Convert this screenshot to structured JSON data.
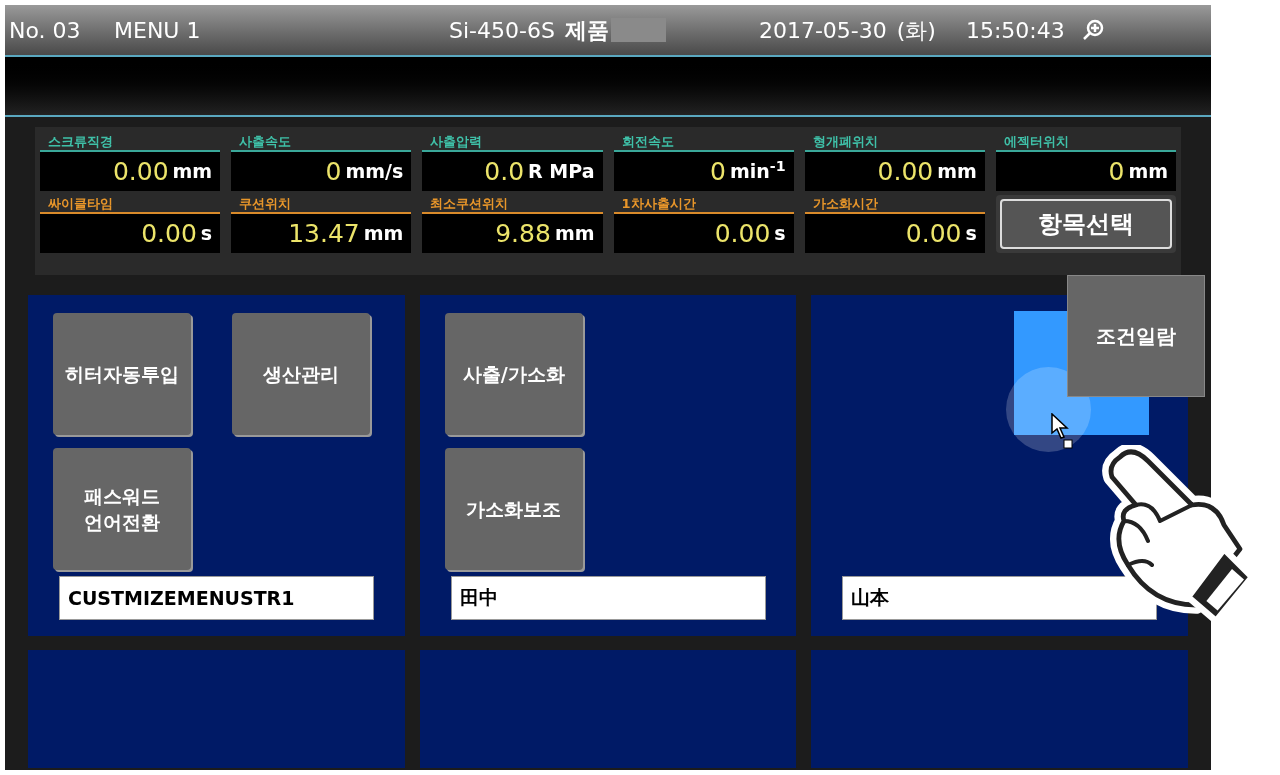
{
  "header": {
    "number": "No. 03",
    "menu": "MENU 1",
    "machine": "Si-450-6S",
    "product": "제품",
    "date": "2017-05-30",
    "weekday": "(화)",
    "time": "15:50:43"
  },
  "metrics": [
    {
      "label": "스크류직경",
      "value": "0.00",
      "unit": "mm",
      "kind": "monitor"
    },
    {
      "label": "사출속도",
      "value": "0",
      "unit": "mm/s",
      "kind": "monitor"
    },
    {
      "label": "사출압력",
      "value": "0.0",
      "unit": "R MPa",
      "kind": "monitor"
    },
    {
      "label": "회전속도",
      "value": "0",
      "unit": "min$^{-1}$",
      "kind": "monitor"
    },
    {
      "label": "형개폐위치",
      "value": "0.00",
      "unit": "mm",
      "kind": "monitor"
    },
    {
      "label": "에젝터위치",
      "value": "0",
      "unit": "mm",
      "kind": "monitor"
    },
    {
      "label": "싸이클타임",
      "value": "0.00",
      "unit": "s",
      "kind": "setting"
    },
    {
      "label": "쿠션위치",
      "value": "13.47",
      "unit": "mm",
      "kind": "setting"
    },
    {
      "label": "최소쿠션위치",
      "value": "9.88",
      "unit": "mm",
      "kind": "setting"
    },
    {
      "label": "1차사출시간",
      "value": "0.00",
      "unit": "s",
      "kind": "setting"
    },
    {
      "label": "가소화시간",
      "value": "0.00",
      "unit": "s",
      "kind": "setting"
    }
  ],
  "select_button": "항목선택",
  "tiles": [
    {
      "kind": "menu",
      "buttons": [
        "히터자동투입",
        "패스워드\n언어전환",
        "생산관리"
      ],
      "name_field": "CUSTMIZEMENUSTR1"
    },
    {
      "kind": "menu",
      "buttons": [
        "사출/가소화",
        "가소화보조"
      ],
      "name_field": "田中"
    },
    {
      "kind": "drop",
      "name_field": "山本",
      "dragged_button": "조건일람"
    },
    {
      "kind": "empty"
    },
    {
      "kind": "empty"
    },
    {
      "kind": "empty"
    }
  ]
}
